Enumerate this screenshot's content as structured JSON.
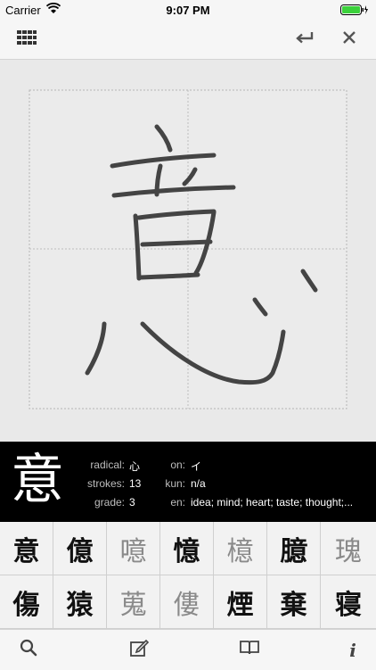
{
  "status_bar": {
    "carrier": "Carrier",
    "time": "9:07 PM"
  },
  "toolbar": {
    "left_icon": "grid-icon",
    "undo_icon": "return-icon",
    "clear_icon": "close-icon"
  },
  "selected": {
    "kanji": "意",
    "radical_label": "radical:",
    "radical": "心",
    "strokes_label": "strokes:",
    "strokes": "13",
    "grade_label": "grade:",
    "grade": "3",
    "on_label": "on:",
    "on": "イ",
    "kun_label": "kun:",
    "kun": "n/a",
    "en_label": "en:",
    "en": "idea; mind; heart; taste; thought;..."
  },
  "candidates": [
    {
      "char": "意",
      "dim": false
    },
    {
      "char": "億",
      "dim": false
    },
    {
      "char": "噫",
      "dim": true
    },
    {
      "char": "憶",
      "dim": false
    },
    {
      "char": "檍",
      "dim": true
    },
    {
      "char": "臆",
      "dim": false
    },
    {
      "char": "瑰",
      "dim": true
    },
    {
      "char": "傷",
      "dim": false
    },
    {
      "char": "猿",
      "dim": false
    },
    {
      "char": "蒐",
      "dim": true
    },
    {
      "char": "僂",
      "dim": true
    },
    {
      "char": "煙",
      "dim": false
    },
    {
      "char": "棄",
      "dim": false
    },
    {
      "char": "寝",
      "dim": false
    }
  ],
  "bottom_bar": [
    "search-icon",
    "compose-icon",
    "book-icon",
    "info-icon"
  ],
  "colors": {
    "stroke": "#444444",
    "panel": "#000000"
  }
}
